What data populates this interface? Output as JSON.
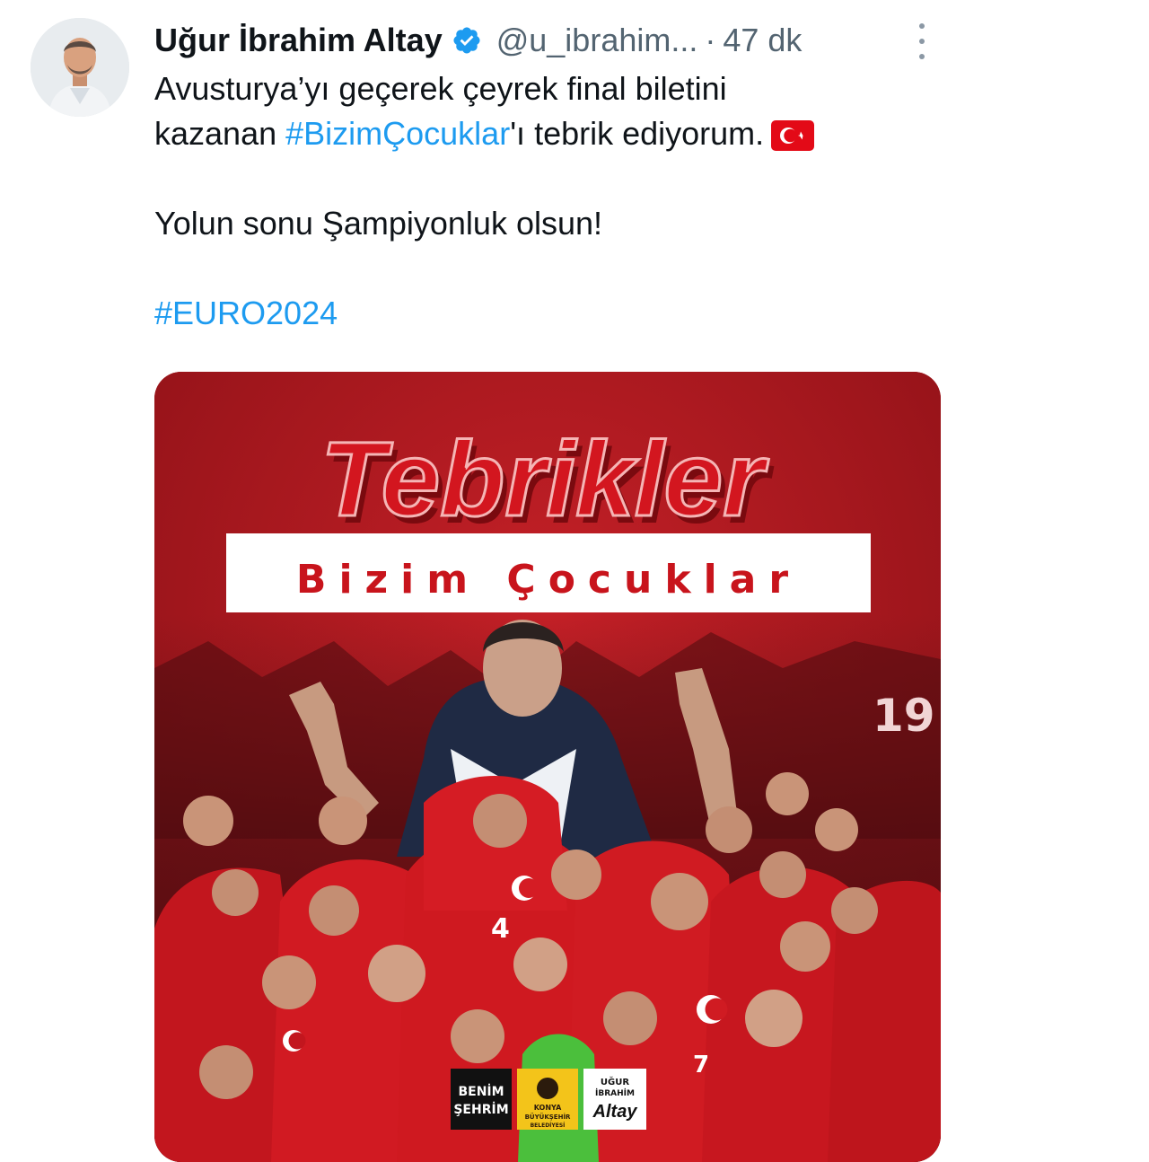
{
  "tweet": {
    "author_name": "Uğur İbrahim Altay",
    "author_handle": "@u_ibrahim...",
    "separator": "·",
    "time": "47 dk",
    "icons": {
      "verified": "verified-badge-icon",
      "more": "more-options-icon",
      "flag": "turkey-flag-icon"
    },
    "text": {
      "line1": "Avusturya’yı geçerek çeyrek final biletini",
      "line2_before": "kazanan ",
      "line2_hashtag": "#BizimÇocuklar",
      "line2_after": "'ı tebrik ediyorum.",
      "line3": "Yolun sonu Şampiyonluk olsun!",
      "hashtag_euro": "#EURO2024"
    }
  },
  "media": {
    "headline": "Tebrikler",
    "subheadline": "Bizim Çocuklar",
    "logos": {
      "logo1_line1": "BENİM",
      "logo1_line2": "ŞEHRİM",
      "logo2_line1": "KONYA",
      "logo2_line2": "BÜYÜKŞEHİR",
      "logo2_line3": "BELEDİYESİ",
      "logo3_line1": "UĞUR",
      "logo3_line2": "İBRAHİM",
      "logo3_line3": "Altay"
    },
    "jersey_numbers": [
      "4",
      "19",
      "7"
    ]
  },
  "colors": {
    "link": "#1d9bf0",
    "secondary_text": "#536471",
    "poster_red": "#b3181e",
    "headline_red": "#c8141c"
  }
}
